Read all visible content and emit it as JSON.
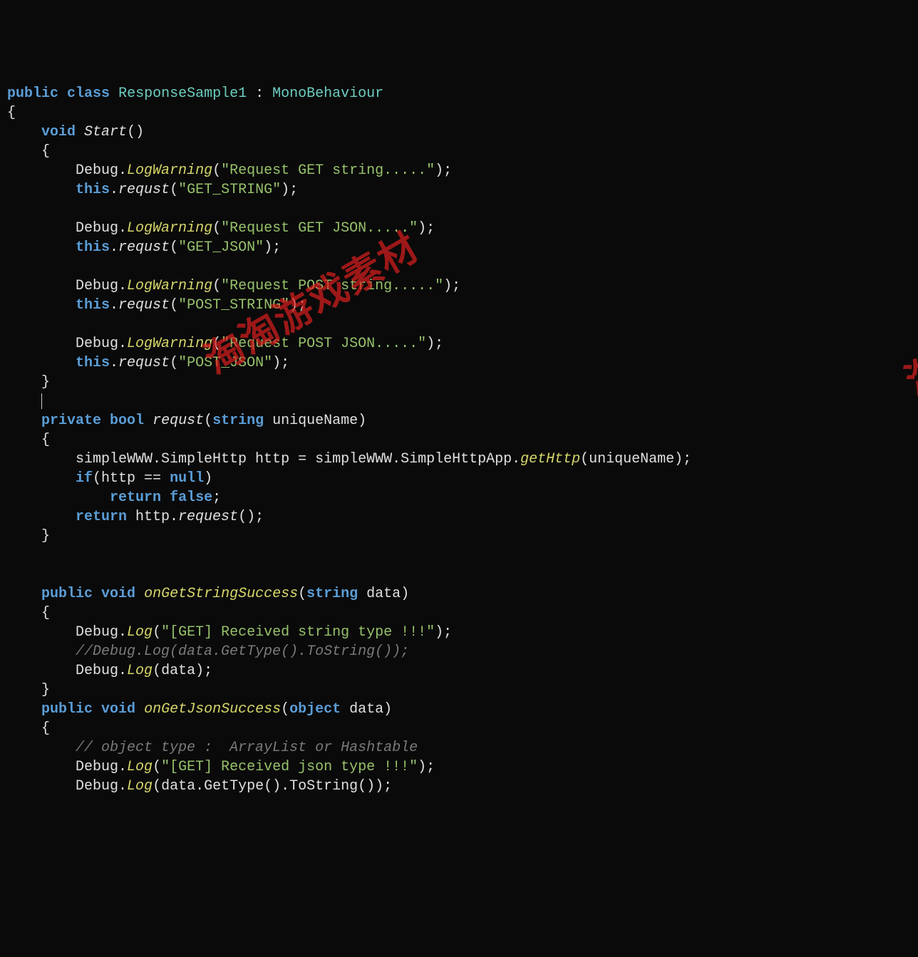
{
  "code": {
    "class_decl": {
      "kw_public": "public",
      "kw_class": "class",
      "name": "ResponseSample1",
      "colon": " : ",
      "base": "MonoBehaviour"
    },
    "start": {
      "kw_void": "void",
      "name": "Start",
      "parens": "()",
      "body": [
        {
          "call": "Debug.LogWarning",
          "arg": "\"Request GET string.....\""
        },
        {
          "call": "this.requst",
          "arg": "\"GET_STRING\""
        },
        null,
        {
          "call": "Debug.LogWarning",
          "arg": "\"Request GET JSON.....\""
        },
        {
          "call": "this.requst",
          "arg": "\"GET_JSON\""
        },
        null,
        {
          "call": "Debug.LogWarning",
          "arg": "\"Request POST string.....\""
        },
        {
          "call": "this.requst",
          "arg": "\"POST_STRING\""
        },
        null,
        {
          "call": "Debug.LogWarning",
          "arg": "\"Request POST JSON.....\""
        },
        {
          "call": "this.requst",
          "arg": "\"POST_JSON\""
        }
      ]
    },
    "requst": {
      "kw_private": "private",
      "kw_bool": "bool",
      "name": "requst",
      "param_type": "string",
      "param_name": "uniqueName",
      "line1_a": "simpleWWW.SimpleHttp http = simpleWWW.SimpleHttpApp.",
      "line1_fn": "getHttp",
      "line1_b": "(uniqueName);",
      "kw_if": "if",
      "if_cond_a": "(http == ",
      "kw_null": "null",
      "if_cond_b": ")",
      "kw_return1": "return",
      "kw_false": "false",
      "kw_return2": "return",
      "ret_expr_a": " http.",
      "ret_fn": "request",
      "ret_expr_b": "();"
    },
    "onGetStringSuccess": {
      "kw_public": "public",
      "kw_void": "void",
      "name": "onGetStringSuccess",
      "param_type": "string",
      "param_name": "data",
      "lines": [
        {
          "call": "Debug.Log",
          "arg": "\"[GET] Received string type !!!\""
        },
        {
          "comment": "//Debug.Log(data.GetType().ToString());"
        },
        {
          "call": "Debug.Log",
          "raw_arg": "data"
        }
      ]
    },
    "onGetJsonSuccess": {
      "kw_public": "public",
      "kw_void": "void",
      "name": "onGetJsonSuccess",
      "param_type": "object",
      "param_name": "data",
      "lines": [
        {
          "comment": "// object type :  ArrayList or Hashtable"
        },
        {
          "call": "Debug.Log",
          "arg": "\"[GET] Received json type !!!\""
        },
        {
          "call": "Debug.Log",
          "raw_arg": "data.GetType().ToString()"
        }
      ]
    }
  },
  "watermark": "淘淘游戏素材",
  "watermark2": "淘"
}
